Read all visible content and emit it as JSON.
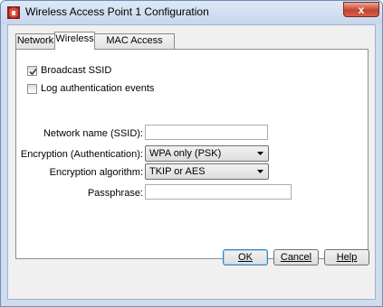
{
  "window": {
    "title": "Wireless Access Point 1 Configuration",
    "close_glyph": "x"
  },
  "tabs": [
    {
      "label": "Network"
    },
    {
      "label": "Wireless",
      "active": true
    },
    {
      "label": "MAC Access Control"
    }
  ],
  "wireless": {
    "broadcast_ssid": {
      "label": "Broadcast SSID",
      "checked": true
    },
    "log_auth_events": {
      "label": "Log authentication events",
      "checked": false
    },
    "network_name": {
      "label": "Network name (SSID):",
      "value": ""
    },
    "encryption": {
      "label": "Encryption (Authentication):",
      "value": "WPA only (PSK)"
    },
    "algorithm": {
      "label": "Encryption algorithm:",
      "value": "TKIP or AES"
    },
    "passphrase": {
      "label": "Passphrase:",
      "value": ""
    }
  },
  "buttons": {
    "ok": "OK",
    "cancel": "Cancel",
    "help": "Help"
  },
  "icons": {
    "app": "firebox-icon",
    "close": "close-icon",
    "check": "check-icon",
    "dropdown": "chevron-down-icon"
  },
  "colors": {
    "close_button": "#c8432e",
    "frame": "#cfdcee",
    "default_button_border": "#3c7fb1"
  }
}
